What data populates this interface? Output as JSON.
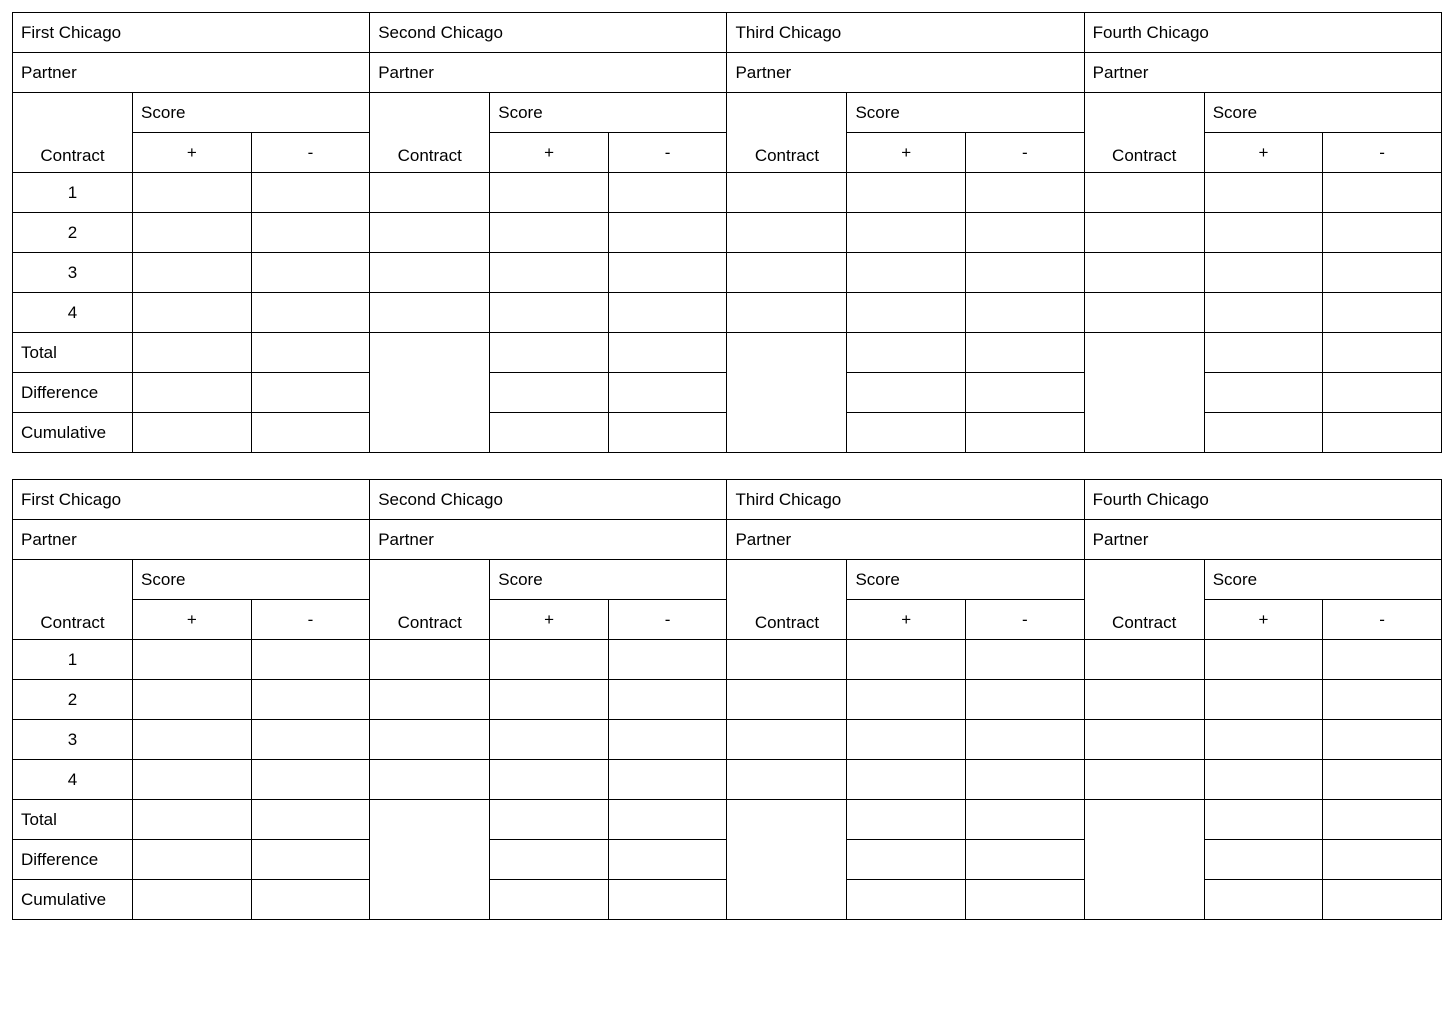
{
  "labels": {
    "panel_titles": [
      "First Chicago",
      "Second Chicago",
      "Third Chicago",
      "Fourth Chicago"
    ],
    "partner": "Partner",
    "score": "Score",
    "contract": "Contract",
    "plus": "+",
    "minus": "-",
    "rows": [
      "1",
      "2",
      "3",
      "4"
    ],
    "total": "Total",
    "difference": "Difference",
    "cumulative": "Cumulative"
  },
  "cards": [
    {
      "panels": [
        {
          "partner": "",
          "rows": [
            {
              "contract": "",
              "plus": "",
              "minus": ""
            },
            {
              "contract": "",
              "plus": "",
              "minus": ""
            },
            {
              "contract": "",
              "plus": "",
              "minus": ""
            },
            {
              "contract": "",
              "plus": "",
              "minus": ""
            }
          ],
          "total": {
            "plus": "",
            "minus": ""
          },
          "difference": {
            "plus": "",
            "minus": ""
          },
          "cumulative": {
            "plus": "",
            "minus": ""
          }
        },
        {
          "partner": "",
          "rows": [
            {
              "contract": "",
              "plus": "",
              "minus": ""
            },
            {
              "contract": "",
              "plus": "",
              "minus": ""
            },
            {
              "contract": "",
              "plus": "",
              "minus": ""
            },
            {
              "contract": "",
              "plus": "",
              "minus": ""
            }
          ],
          "total": {
            "plus": "",
            "minus": ""
          },
          "difference": {
            "plus": "",
            "minus": ""
          },
          "cumulative": {
            "plus": "",
            "minus": ""
          }
        },
        {
          "partner": "",
          "rows": [
            {
              "contract": "",
              "plus": "",
              "minus": ""
            },
            {
              "contract": "",
              "plus": "",
              "minus": ""
            },
            {
              "contract": "",
              "plus": "",
              "minus": ""
            },
            {
              "contract": "",
              "plus": "",
              "minus": ""
            }
          ],
          "total": {
            "plus": "",
            "minus": ""
          },
          "difference": {
            "plus": "",
            "minus": ""
          },
          "cumulative": {
            "plus": "",
            "minus": ""
          }
        },
        {
          "partner": "",
          "rows": [
            {
              "contract": "",
              "plus": "",
              "minus": ""
            },
            {
              "contract": "",
              "plus": "",
              "minus": ""
            },
            {
              "contract": "",
              "plus": "",
              "minus": ""
            },
            {
              "contract": "",
              "plus": "",
              "minus": ""
            }
          ],
          "total": {
            "plus": "",
            "minus": ""
          },
          "difference": {
            "plus": "",
            "minus": ""
          },
          "cumulative": {
            "plus": "",
            "minus": ""
          }
        }
      ]
    },
    {
      "panels": [
        {
          "partner": "",
          "rows": [
            {
              "contract": "",
              "plus": "",
              "minus": ""
            },
            {
              "contract": "",
              "plus": "",
              "minus": ""
            },
            {
              "contract": "",
              "plus": "",
              "minus": ""
            },
            {
              "contract": "",
              "plus": "",
              "minus": ""
            }
          ],
          "total": {
            "plus": "",
            "minus": ""
          },
          "difference": {
            "plus": "",
            "minus": ""
          },
          "cumulative": {
            "plus": "",
            "minus": ""
          }
        },
        {
          "partner": "",
          "rows": [
            {
              "contract": "",
              "plus": "",
              "minus": ""
            },
            {
              "contract": "",
              "plus": "",
              "minus": ""
            },
            {
              "contract": "",
              "plus": "",
              "minus": ""
            },
            {
              "contract": "",
              "plus": "",
              "minus": ""
            }
          ],
          "total": {
            "plus": "",
            "minus": ""
          },
          "difference": {
            "plus": "",
            "minus": ""
          },
          "cumulative": {
            "plus": "",
            "minus": ""
          }
        },
        {
          "partner": "",
          "rows": [
            {
              "contract": "",
              "plus": "",
              "minus": ""
            },
            {
              "contract": "",
              "plus": "",
              "minus": ""
            },
            {
              "contract": "",
              "plus": "",
              "minus": ""
            },
            {
              "contract": "",
              "plus": "",
              "minus": ""
            }
          ],
          "total": {
            "plus": "",
            "minus": ""
          },
          "difference": {
            "plus": "",
            "minus": ""
          },
          "cumulative": {
            "plus": "",
            "minus": ""
          }
        },
        {
          "partner": "",
          "rows": [
            {
              "contract": "",
              "plus": "",
              "minus": ""
            },
            {
              "contract": "",
              "plus": "",
              "minus": ""
            },
            {
              "contract": "",
              "plus": "",
              "minus": ""
            },
            {
              "contract": "",
              "plus": "",
              "minus": ""
            }
          ],
          "total": {
            "plus": "",
            "minus": ""
          },
          "difference": {
            "plus": "",
            "minus": ""
          },
          "cumulative": {
            "plus": "",
            "minus": ""
          }
        }
      ]
    }
  ]
}
